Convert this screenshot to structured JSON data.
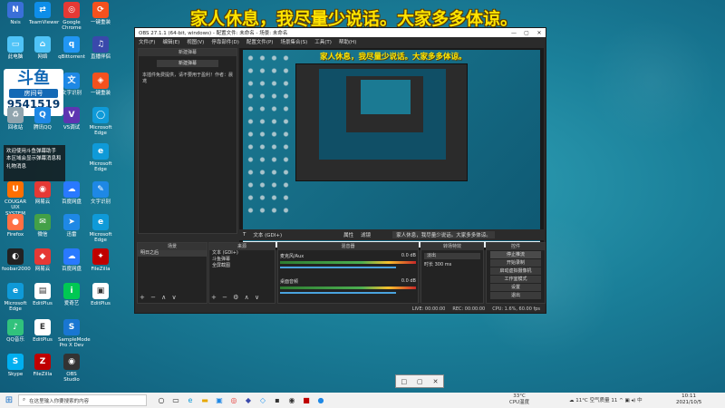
{
  "banner": "家人休息，我尽量少说话。大家多多体谅。",
  "desktop": {
    "douyu_logo_text": "斗鱼",
    "douyu_role": "房间号",
    "douyu_room": "9541519",
    "notification_1": "欢迎使用斗鱼弹幕助手",
    "notification_2": "本区域会显示弹幕消息和礼物消息",
    "icons": [
      {
        "label": "Nsis",
        "color": "#3a6fd8"
      },
      {
        "label": "TeamViewer",
        "color": "#0e8ee9"
      },
      {
        "label": "Google Chrome",
        "color": "#e53935"
      },
      {
        "label": "一键重装",
        "color": "#f4511e"
      },
      {
        "label": "此电脑",
        "color": "#4fc3f7"
      },
      {
        "label": "网络",
        "color": "#4fc3f7"
      },
      {
        "label": "qBittorrent",
        "color": "#2196f3"
      },
      {
        "label": "直播伴侣",
        "color": "#3949ab"
      },
      {
        "label": "OBS Studio",
        "color": "#333333"
      },
      {
        "label": "文字识别",
        "color": "#1e88e5"
      },
      {
        "label": "Firefox",
        "color": "#ff7043"
      },
      {
        "label": "微信",
        "color": "#43a047"
      },
      {
        "label": "迅雷",
        "color": "#1e88e5"
      },
      {
        "label": "Microsoft Edge",
        "color": "#0f9ad8"
      },
      {
        "label": "QQ音乐",
        "color": "#31c27c"
      },
      {
        "label": "Skype",
        "color": "#00aff0"
      },
      {
        "label": "FileZilla",
        "color": "#bf0000"
      },
      {
        "label": "foobar2000",
        "color": "#222222"
      },
      {
        "label": "EditPlus",
        "color": "#ffffff"
      },
      {
        "label": "SampleMode Pro X Dev",
        "color": "#1976d2"
      },
      {
        "label": "网易云",
        "color": "#e53935"
      },
      {
        "label": "COUGAR UIX SYSTEM",
        "color": "#ff6f00"
      },
      {
        "label": "百度网盘",
        "color": "#2979ff"
      },
      {
        "label": "爱奇艺",
        "color": "#00c853"
      },
      {
        "label": "回收站",
        "color": "#90a4ae"
      },
      {
        "label": "腾讯QQ",
        "color": "#1e88e5"
      },
      {
        "label": "VS调试",
        "color": "#5e35b1"
      },
      {
        "label": "OBS Studio",
        "color": "#333333"
      }
    ]
  },
  "obs": {
    "title": "OBS 27.1.1 (64-bit, windows) - 配置文件: 未命名 - 场景: 未命名",
    "menu": [
      "文件(F)",
      "编辑(E)",
      "视图(V)",
      "停靠部件(D)",
      "配置文件(P)",
      "场景集合(S)",
      "工具(T)",
      "帮助(H)"
    ],
    "left_dock_title": "新建弹幕",
    "left_dock_button": "新建弹幕",
    "left_dock_text": "本插件免费提供，请不要用于盈利！作者：晨鸢",
    "preview_banner": "家人休息，我尽量少说话。大家多多体谅。",
    "toolbar_text": "文本 (GDI+)",
    "tool_tabs": [
      "属性",
      "滤镜"
    ],
    "right_tabs": [
      "家人休息，我尽量少说话。大家多多体谅。"
    ],
    "scenes_title": "场景",
    "scenes": [
      "明日之后"
    ],
    "sources_title": "来源",
    "sources": [
      "文本 (GDI+)",
      "斗鱼弹幕",
      "全屏截图"
    ],
    "mixer_title": "混音器",
    "mixer": [
      {
        "name": "麦克风/Aux",
        "db": "0.0 dB"
      },
      {
        "name": "桌面音频",
        "db": "0.0 dB"
      }
    ],
    "transitions_title": "转场特效",
    "transition_type": "淡出",
    "transition_duration_label": "时长",
    "transition_duration": "300 ms",
    "controls_title": "控件",
    "controls": [
      "停止推流",
      "开始录制",
      "启动虚拟摄像机",
      "工作室模式",
      "设置",
      "退出"
    ],
    "status": {
      "live": "LIVE: 00:00:00",
      "rec": "REC: 00:00:00",
      "cpu": "CPU: 1.6%, 60.00 fps"
    }
  },
  "popup_icons": [
    "窗口",
    "最大化",
    "关闭"
  ],
  "taskbar": {
    "search_placeholder": "在这里输入你要搜索的内容",
    "weather_temp": "33°C",
    "weather_label": "CPU温度",
    "tray_text": "11°C 空气质量 11",
    "tray_lang": "中",
    "time": "10:11",
    "date": "2021/10/5"
  }
}
